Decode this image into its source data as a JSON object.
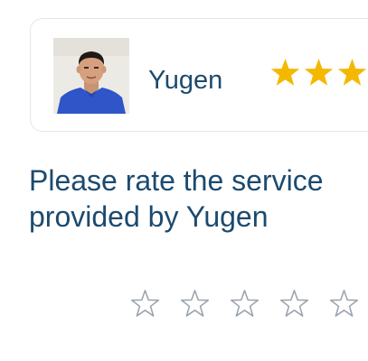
{
  "provider": {
    "name": "Yugen",
    "avatar_alt": "Yugen",
    "rating_stars": 3,
    "star_color": "#f5b800"
  },
  "prompt": {
    "text": "Please rate the service provided by Yugen"
  },
  "rating_input": {
    "selected": 0,
    "max": 5,
    "empty_star_color": "#9aa3ad"
  },
  "colors": {
    "text_primary": "#1c4a6e",
    "card_border": "#e3e6ea"
  }
}
